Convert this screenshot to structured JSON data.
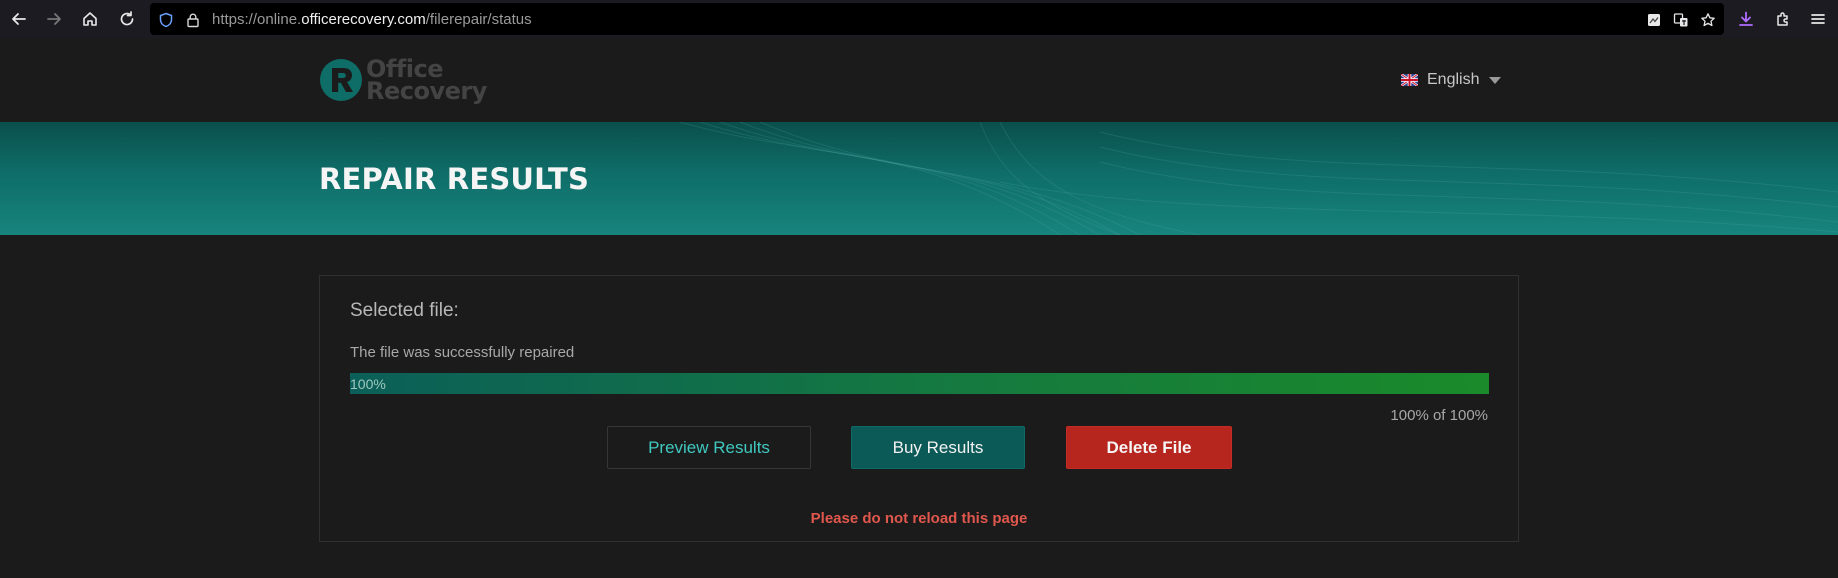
{
  "browser": {
    "url_prefix": "https://online.",
    "url_domain": "officerecovery.com",
    "url_path": "/filerepair/status",
    "accent_download": "#b06cff"
  },
  "header": {
    "logo_line1": "Office",
    "logo_line2": "Recovery",
    "language": "English"
  },
  "hero": {
    "title": "REPAIR RESULTS"
  },
  "card": {
    "selected_label": "Selected file:",
    "status_text": "The file was successfully repaired",
    "progress": {
      "value": 100,
      "label": "100%",
      "count_text": "100% of 100%"
    },
    "buttons": {
      "preview": "Preview Results",
      "buy": "Buy Results",
      "delete": "Delete File"
    },
    "warning": "Please do not reload this page"
  },
  "colors": {
    "teal": "#0c5a57",
    "teal_text": "#3fc9c0",
    "danger": "#b7261e",
    "warning_text": "#e0574d"
  }
}
